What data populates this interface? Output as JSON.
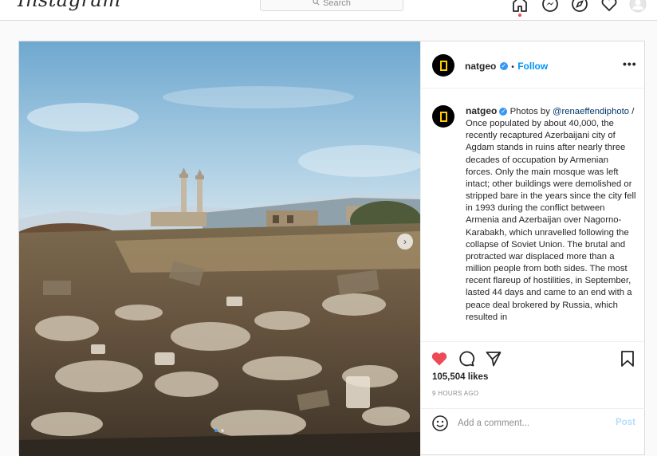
{
  "nav": {
    "logo": "Instagram",
    "search_placeholder": "Search",
    "icons": [
      "home-icon",
      "messenger-icon",
      "explore-icon",
      "heart-icon",
      "profile-avatar"
    ]
  },
  "post": {
    "username": "natgeo",
    "follow_label": "Follow",
    "separator": "•",
    "more_label": "•••",
    "caption_prefix": "Photos by",
    "mention": "@renaeffendiphoto",
    "caption_body": " / Once populated by about 40,000, the recently recaptured Azerbaijani city of Agdam stands in ruins after nearly three decades of occupation by Armenian forces. Only the main mosque was left intact; other buildings were demolished or stripped bare in the years since the city fell in 1993 during the conflict between Armenia and Azerbaijan over Nagorno-Karabakh, which unravelled following the collapse of Soviet Union. The brutal and protracted war displaced more than a million people from both sides. The most recent flareup of hostilities, in September, lasted 44 days and came to an end with a peace deal brokered by Russia, which resulted in",
    "likes": "105,504 likes",
    "time": "9 HOURS AGO",
    "comment_placeholder": "Add a comment...",
    "post_label": "Post",
    "carousel_pages": 2,
    "carousel_current": 1
  },
  "colors": {
    "accent": "#0095f6",
    "liked": "#ed4956",
    "natgeo_yellow": "#ffce00"
  }
}
